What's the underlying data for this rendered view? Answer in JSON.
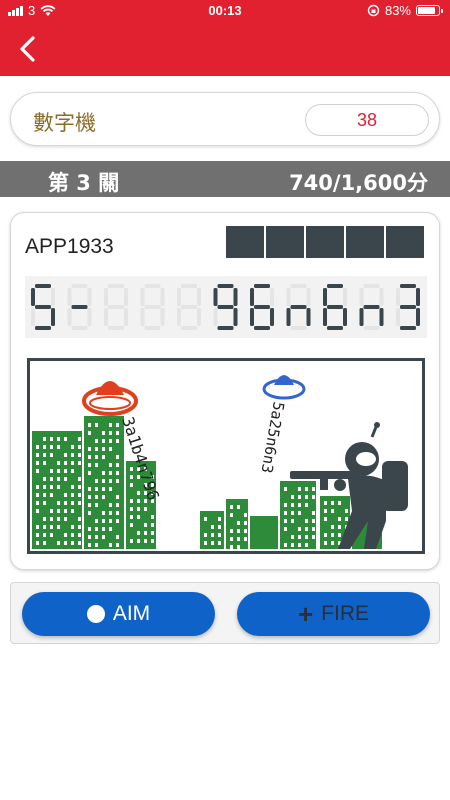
{
  "status_bar": {
    "carrier": "3",
    "time": "00:13",
    "battery_text": "83%",
    "battery_level": 0.83
  },
  "nav": {
    "back_icon": "chevron-left-icon"
  },
  "device": {
    "name": "數字機",
    "count": "38"
  },
  "level": {
    "label": "第 3 關",
    "score": "740/1,600分"
  },
  "game": {
    "app_code": "APP1933",
    "lives_total": 5,
    "lcd_display": [
      "5",
      "-",
      "",
      "",
      "",
      "9",
      "6",
      "n",
      "6",
      "n",
      "3"
    ],
    "falling_numbers_red": "3a1b4n796",
    "falling_numbers_blue": "5a25n6n3",
    "colors": {
      "accent": "#e22130",
      "lcd": "#3b454c",
      "city": "#2e8b3a",
      "ufo_red": "#e0401f",
      "ufo_blue": "#3366cc"
    }
  },
  "controls": {
    "aim_label": "AIM",
    "fire_label": "FIRE",
    "aim_icon": "circle-icon",
    "fire_icon": "plus-icon"
  }
}
